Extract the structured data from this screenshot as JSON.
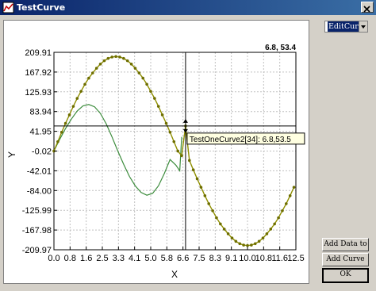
{
  "window": {
    "title": "TestCurve"
  },
  "controls": {
    "combo_value": "EditCurv",
    "add_data_label": "Add Data to",
    "add_curve_label": "Add Curve",
    "ok_label": "OK"
  },
  "colors": {
    "curve1": "#8f8f00",
    "marker1": "#6e6e00",
    "curve2": "#3c8c3c",
    "grid": "#c0c0c0",
    "titlebar": "#0a246a"
  },
  "chart_data": {
    "type": "line",
    "xlabel": "X",
    "ylabel": "Y",
    "xlim": [
      0,
      12.5
    ],
    "ylim": [
      -209.97,
      209.91
    ],
    "x_ticks": [
      "0.0",
      "0.8",
      "1.6",
      "2.5",
      "3.3",
      "4.1",
      "5.0",
      "5.8",
      "6.6",
      "7.5",
      "8.3",
      "9.1",
      "10.0",
      "10.8",
      "11.6",
      "12.5"
    ],
    "y_ticks": [
      "209.91",
      "167.92",
      "125.93",
      "83.94",
      "41.95",
      "-0.02",
      "-42.01",
      "-84.00",
      "-125.99",
      "-167.98",
      "-209.97"
    ],
    "grid": true,
    "cursor": {
      "x": 6.8,
      "y": 53.4,
      "readout": "6.8, 53.4"
    },
    "tooltip": "TestOneCurve2[34]: 6.8,53.5",
    "series": [
      {
        "color": "olive-with-markers",
        "x": [
          0.0,
          0.2,
          0.4,
          0.6,
          0.8,
          1.0,
          1.2,
          1.4,
          1.6,
          1.8,
          2.0,
          2.2,
          2.4,
          2.6,
          2.8,
          3.0,
          3.2,
          3.4,
          3.6,
          3.8,
          4.0,
          4.2,
          4.4,
          4.6,
          4.8,
          5.0,
          5.2,
          5.4,
          5.6,
          5.8,
          6.0,
          6.2,
          6.4,
          6.6,
          6.8,
          7.0,
          7.2,
          7.4,
          7.6,
          7.8,
          8.0,
          8.2,
          8.4,
          8.6,
          8.8,
          9.0,
          9.2,
          9.4,
          9.6,
          9.8,
          10.0,
          10.2,
          10.4,
          10.6,
          10.8,
          11.0,
          11.2,
          11.4,
          11.6,
          11.8,
          12.0,
          12.2,
          12.4
        ],
        "values": [
          0,
          20,
          40,
          59,
          77,
          95,
          112,
          127,
          142,
          155,
          166,
          176,
          185,
          192,
          197,
          200,
          201,
          200,
          197,
          192,
          185,
          176,
          166,
          155,
          142,
          127,
          112,
          95,
          77,
          59,
          40,
          20,
          0,
          -10,
          53.5,
          -20,
          -40,
          -59,
          -77,
          -95,
          -112,
          -127,
          -142,
          -155,
          -166,
          -176,
          -185,
          -192,
          -197,
          -200,
          -201,
          -200,
          -197,
          -192,
          -185,
          -176,
          -166,
          -155,
          -142,
          -127,
          -112,
          -95,
          -77
        ]
      },
      {
        "color": "green",
        "x": [
          0.0,
          0.3,
          0.6,
          0.9,
          1.2,
          1.5,
          1.8,
          2.1,
          2.4,
          2.7,
          3.0,
          3.3,
          3.6,
          3.9,
          4.2,
          4.5,
          4.8,
          5.1,
          5.4,
          5.7,
          6.0,
          6.3,
          6.5,
          6.6
        ],
        "values": [
          0,
          25,
          48,
          68,
          85,
          96,
          99,
          94,
          80,
          58,
          30,
          0,
          -28,
          -54,
          -74,
          -88,
          -94,
          -90,
          -74,
          -48,
          -18,
          -30,
          -42,
          30
        ]
      }
    ]
  }
}
